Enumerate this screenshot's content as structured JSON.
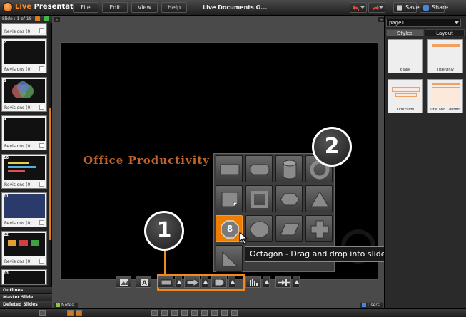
{
  "app": {
    "title_prefix": "Live",
    "title_suffix": " Presentations"
  },
  "menu": [
    {
      "label": "File"
    },
    {
      "label": "Edit"
    },
    {
      "label": "View"
    },
    {
      "label": "Help"
    }
  ],
  "document": {
    "title": "Live Documents  O..."
  },
  "toolbar": {
    "save_label": "Save",
    "share_label": "Share"
  },
  "slides_panel": {
    "header": "Slide : 1 of 18",
    "thumbnails": [
      {
        "number": "7",
        "revisions": "Revisions (0)"
      },
      {
        "number": "8",
        "revisions": "Revisions (0)"
      },
      {
        "number": "9",
        "revisions": "Revisions (0)"
      },
      {
        "number": "10",
        "revisions": "Revisions (0)"
      },
      {
        "number": "11",
        "revisions": "Revisions (0)"
      },
      {
        "number": "12",
        "revisions": "Revisions (0)"
      },
      {
        "number": "13",
        "revisions": ""
      }
    ],
    "first_revisions": "Revisions (0)",
    "sections": {
      "outlines": "Outlines",
      "master": "Master Slide",
      "deleted": "Deleted Slides"
    }
  },
  "slide": {
    "text": "Office Productivity"
  },
  "tooltip": {
    "text": "Octagon - Drag and drop into slide"
  },
  "selected_shape": {
    "number": "8"
  },
  "callouts": {
    "one": "1",
    "two": "2"
  },
  "right_panel": {
    "page_select": "page1",
    "tabs": {
      "styles": "Styles",
      "layout": "Layout"
    },
    "layouts": [
      {
        "label": "Blank"
      },
      {
        "label": "Title Only"
      },
      {
        "label": "Title Slide"
      },
      {
        "label": "Title and Content"
      }
    ]
  },
  "bottom": {
    "notes": "Notes",
    "users": "Users"
  },
  "colors": {
    "accent": "#f08a1a",
    "selected": "#ee7d00",
    "slide_text": "#c0622a"
  },
  "icons": [
    "app-logo-icon",
    "undo-icon",
    "redo-icon",
    "save-icon",
    "share-icon",
    "image-icon",
    "text-icon",
    "rectangle-icon",
    "arrow-icon",
    "rounded-shape-icon",
    "chart-icon",
    "connector-icon"
  ]
}
